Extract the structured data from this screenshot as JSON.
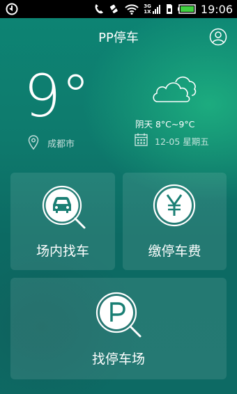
{
  "status_bar": {
    "time": "19:06",
    "network_label_top": "3G",
    "network_label_bottom": "1X",
    "icons": [
      "sync-icon",
      "phone-icon",
      "mute-icon",
      "wifi-icon",
      "signal-icon",
      "sim-icon",
      "battery-icon"
    ]
  },
  "header": {
    "title": "PP停车",
    "profile_icon": "user-icon"
  },
  "weather": {
    "temperature": "9°",
    "city": "成都市",
    "condition": "阴天 8°C~9°C",
    "date": "12-05 星期五",
    "icons": [
      "location-pin-icon",
      "cloud-icon",
      "calendar-icon"
    ]
  },
  "actions": [
    {
      "label": "场内找车",
      "icon": "car-search-icon"
    },
    {
      "label": "缴停车费",
      "icon": "yen-icon"
    },
    {
      "label": "找停车场",
      "icon": "parking-search-icon"
    }
  ],
  "colors": {
    "background": "#0e7a6d",
    "accent": "#1fcf8c",
    "text": "#ffffff"
  }
}
